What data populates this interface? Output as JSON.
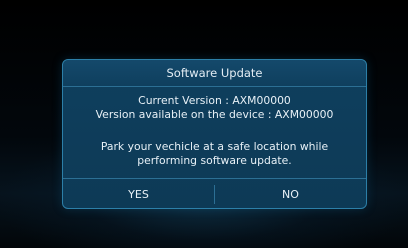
{
  "dialog": {
    "title": "Software Update",
    "current_version": "Current Version : AXM00000",
    "available_version": "Version available on the device : AXM00000",
    "message_line1": "Park your vechicle at a safe location while",
    "message_line2": "performing software update.",
    "yes_label": "YES",
    "no_label": "NO"
  },
  "colors": {
    "background": "#000000",
    "dialog_fill": "#0f3f5e",
    "dialog_border": "#2c7fa8",
    "text": "#e8f1f7"
  }
}
